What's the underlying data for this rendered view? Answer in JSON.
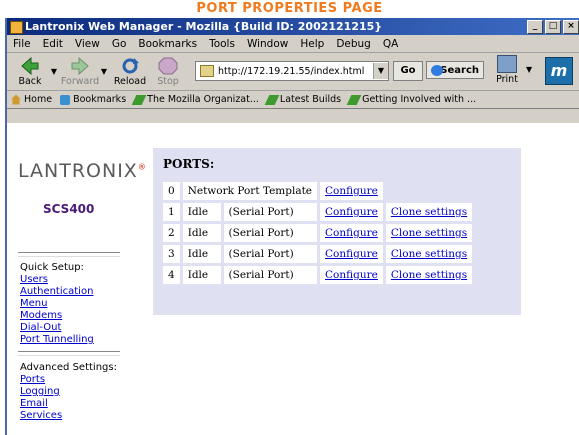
{
  "caption": "PORT PROPERTIES PAGE",
  "window": {
    "title": "Lantronix Web Manager - Mozilla {Build ID: 2002121215}",
    "buttons": [
      "_",
      "□",
      "×"
    ]
  },
  "menu": [
    "File",
    "Edit",
    "View",
    "Go",
    "Bookmarks",
    "Tools",
    "Window",
    "Help",
    "Debug",
    "QA"
  ],
  "toolbar": {
    "back": "Back",
    "forward": "Forward",
    "reload": "Reload",
    "stop": "Stop",
    "url": "http://172.19.21.55/index.html",
    "go": "Go",
    "search": "Search",
    "print": "Print"
  },
  "bookmarks": [
    "Home",
    "Bookmarks",
    "The Mozilla Organizat...",
    "Latest Builds",
    "Getting Involved with ..."
  ],
  "sidebar": {
    "logo": "LANTRONIX",
    "model": "SCS400",
    "quick_setup_title": "Quick Setup:",
    "quick_setup": [
      "Users",
      "Authentication",
      "Menu",
      "Modems",
      "Dial-Out",
      "Port Tunnelling"
    ],
    "advanced_title": "Advanced Settings:",
    "advanced": [
      "Ports",
      "Logging",
      "Email",
      "Services"
    ]
  },
  "ports": {
    "title": "PORTS:",
    "configure_label": "Configure",
    "clone_label": "Clone settings",
    "rows": [
      {
        "num": "0",
        "status": "",
        "name": "Network Port Template",
        "clone": false
      },
      {
        "num": "1",
        "status": "Idle",
        "name": "(Serial Port)",
        "clone": true
      },
      {
        "num": "2",
        "status": "Idle",
        "name": "(Serial Port)",
        "clone": true
      },
      {
        "num": "3",
        "status": "Idle",
        "name": "(Serial Port)",
        "clone": true
      },
      {
        "num": "4",
        "status": "Idle",
        "name": "(Serial Port)",
        "clone": true
      }
    ]
  }
}
